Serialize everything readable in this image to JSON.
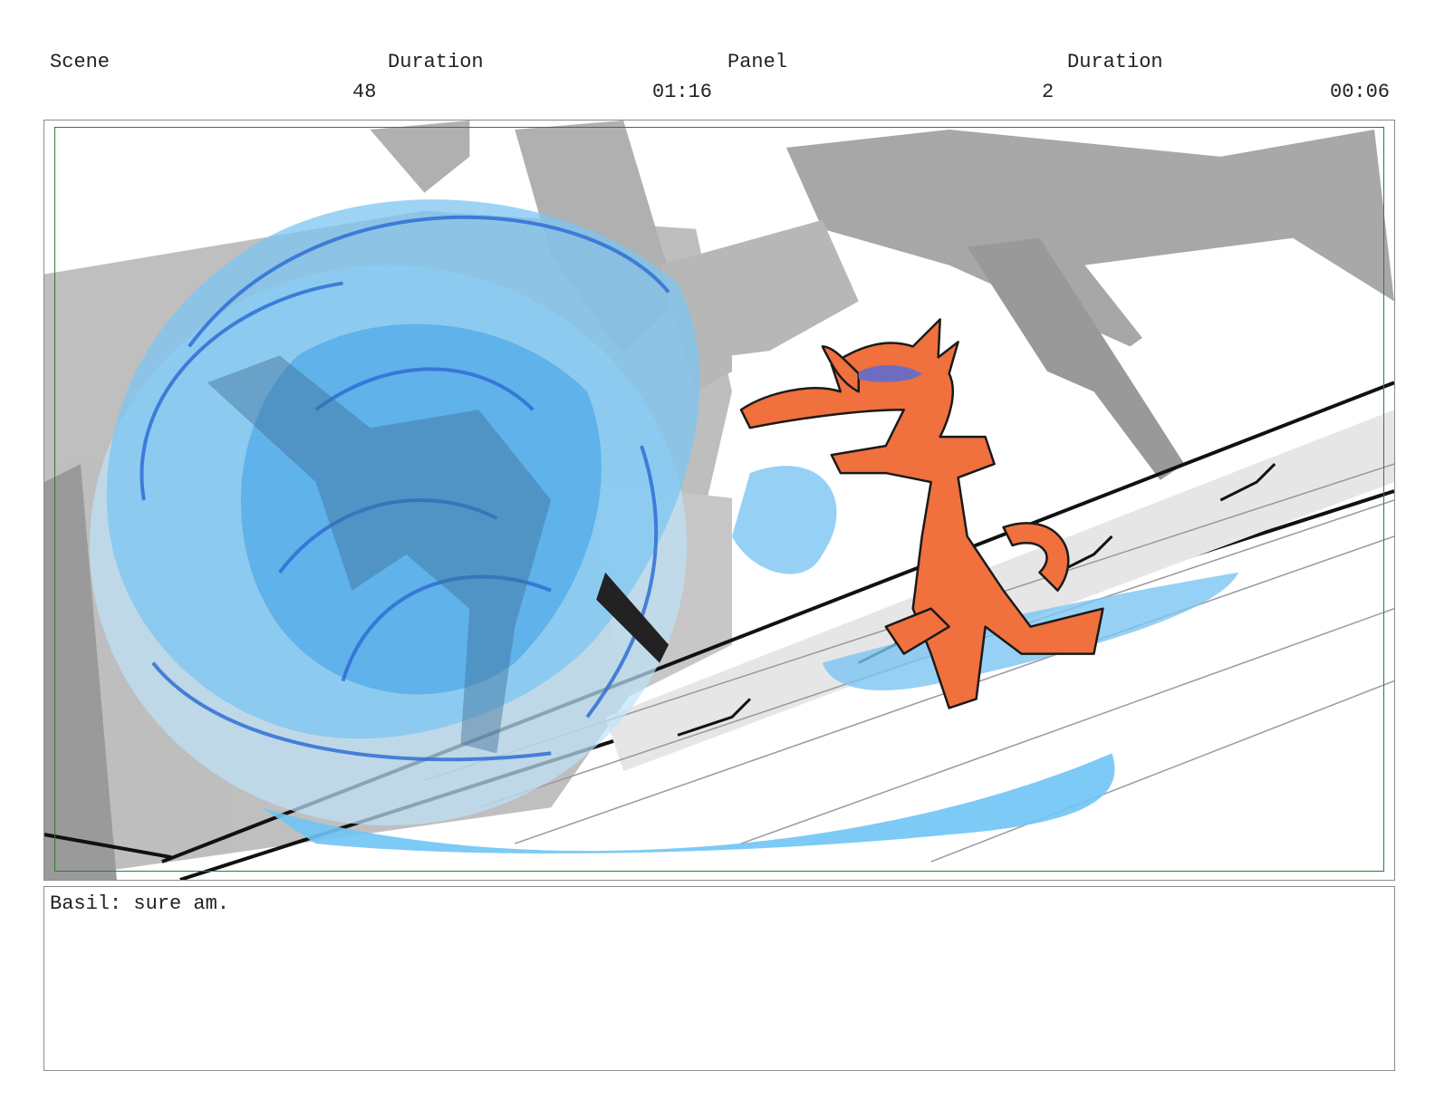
{
  "header": {
    "scene_label": "Scene",
    "scene_duration_label": "Duration",
    "panel_label": "Panel",
    "panel_duration_label": "Duration"
  },
  "values": {
    "scene_number": "48",
    "scene_duration": "01:16",
    "panel_number": "2",
    "panel_duration": "00:06"
  },
  "dialogue": "Basil: sure am.",
  "colors": {
    "frame_border": "#8a8a8a",
    "safe_area_border": "#2e7d2e",
    "character_orange": "#f0703e",
    "water_blue": "#5bb8f0",
    "background_grey": "#9a9a9a"
  }
}
